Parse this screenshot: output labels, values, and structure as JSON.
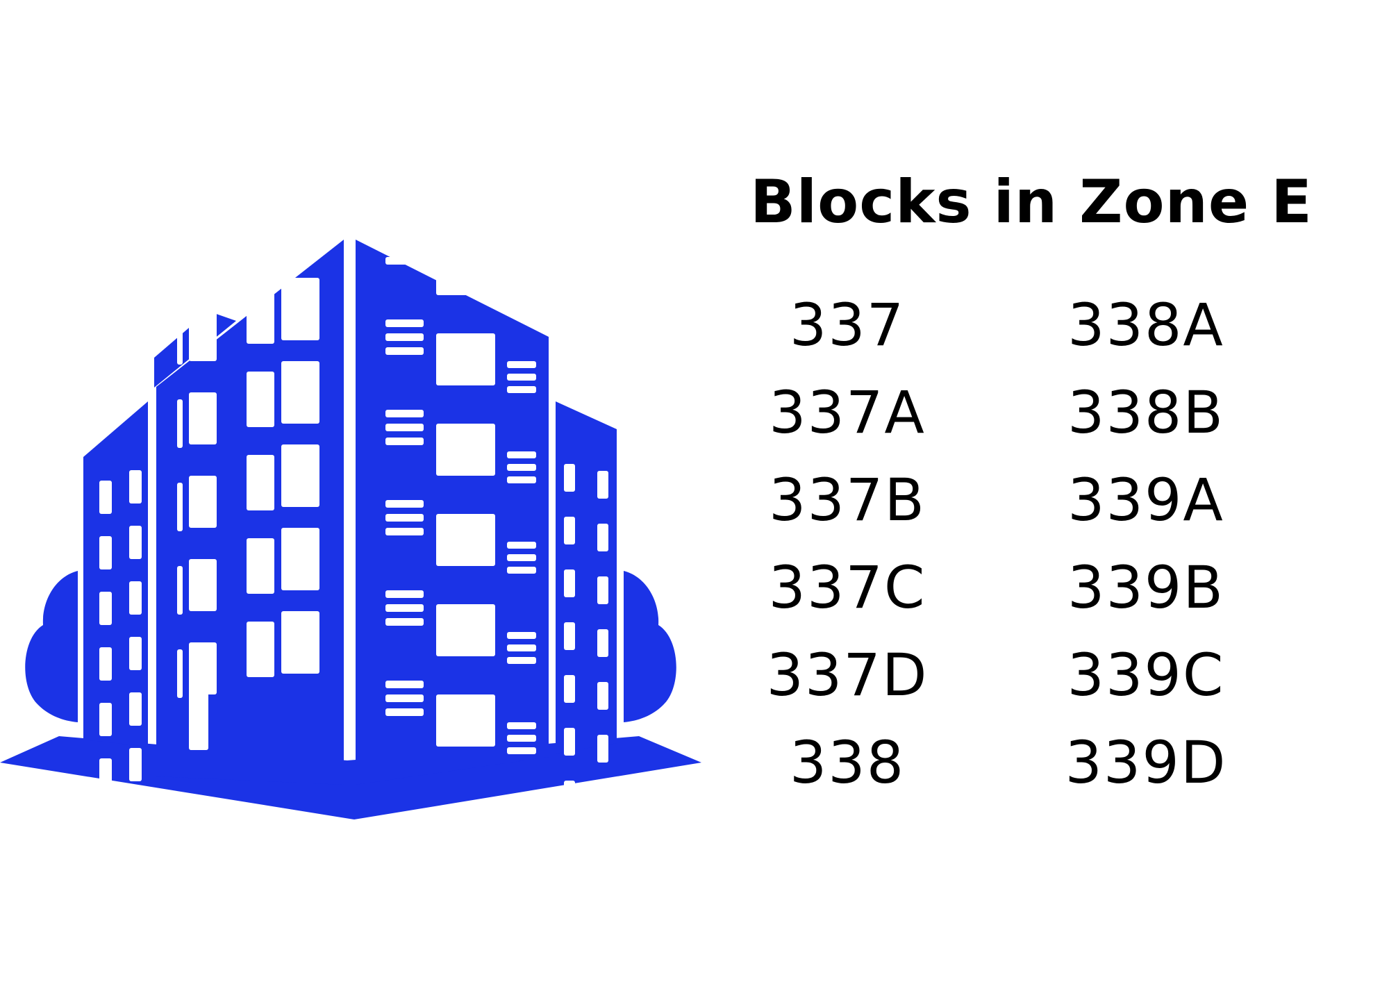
{
  "title": "Blocks in Zone E",
  "colors": {
    "building": "#1b33e6",
    "text": "#000000",
    "background": "#ffffff"
  },
  "illustration": {
    "icon": "apartment-building-icon"
  },
  "blocks": {
    "left": [
      "337",
      "337A",
      "337B",
      "337C",
      "337D",
      "338"
    ],
    "right": [
      "338A",
      "338B",
      "339A",
      "339B",
      "339C",
      "339D"
    ]
  }
}
